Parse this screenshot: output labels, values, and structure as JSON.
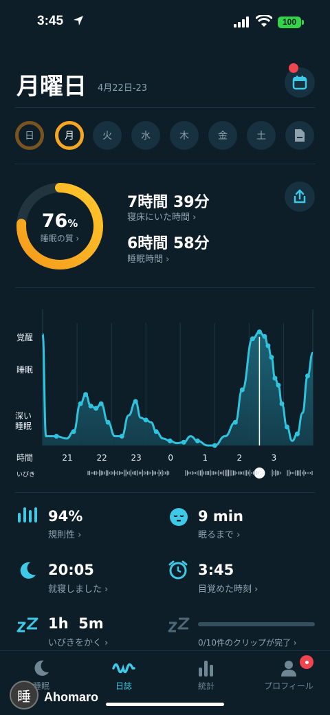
{
  "status_bar": {
    "time": "3:45",
    "battery": "100"
  },
  "header": {
    "title": "月曜日",
    "date_range": "4月22日-23"
  },
  "week_days": [
    "日",
    "月",
    "火",
    "水",
    "木",
    "金",
    "土"
  ],
  "summary": {
    "quality_value": "76",
    "quality_unit": "%",
    "quality_label": "睡眠の質 ›",
    "quality_fraction": 0.76,
    "time_in_bed": "7時間 39分",
    "time_in_bed_label": "寝床にいた時間 ›",
    "sleep_time": "6時間 58分",
    "sleep_time_label": "睡眠時間 ›"
  },
  "chart_data": {
    "type": "area",
    "y_levels": [
      "覚醒",
      "睡眠",
      "深い睡眠"
    ],
    "x_axis_label": "時間",
    "x_ticks": [
      "21",
      "22",
      "23",
      "0",
      "1",
      "2",
      "3"
    ],
    "snore_label": "いびき",
    "note": "sleep depth over time; 0 = 覚醒, 1 = 睡眠, 2 = 深い睡眠, 2.4 = bottom",
    "x": [
      20.0,
      20.1,
      20.4,
      20.7,
      20.9,
      21.1,
      21.25,
      21.4,
      21.55,
      21.7,
      21.9,
      22.1,
      22.3,
      22.5,
      22.7,
      22.85,
      23.0,
      23.15,
      23.3,
      23.5,
      23.7,
      23.9,
      24.1,
      24.3,
      24.5,
      24.8,
      25.0,
      25.3,
      25.6,
      25.8,
      26.1,
      26.3,
      26.45,
      26.55,
      26.65,
      26.75,
      26.85,
      26.95,
      27.1,
      27.25,
      27.4,
      27.55,
      27.7,
      27.85
    ],
    "y": [
      0.0,
      2.2,
      2.2,
      2.25,
      2.1,
      1.5,
      1.3,
      1.55,
      1.6,
      1.5,
      1.9,
      2.2,
      2.2,
      1.75,
      1.45,
      1.8,
      1.85,
      1.9,
      2.1,
      2.25,
      2.3,
      2.35,
      2.33,
      2.2,
      2.3,
      2.4,
      2.4,
      2.2,
      1.9,
      1.2,
      0.1,
      -0.05,
      0.05,
      0.25,
      0.5,
      0.95,
      1.1,
      1.5,
      2.0,
      2.3,
      2.15,
      1.7,
      0.9,
      0.4
    ],
    "current_time_x": 26.3
  },
  "stats": [
    {
      "icon": "regularity-icon",
      "value": "94%",
      "label": "規則性 ›"
    },
    {
      "icon": "sleepy-face-icon",
      "value": "9 min",
      "label": "眠るまで ›"
    },
    {
      "icon": "moon-icon",
      "value": "20:05",
      "label": "就寝しました ›"
    },
    {
      "icon": "alarm-clock-icon",
      "value": "3:45",
      "label": "目覚めた時刻 ›"
    },
    {
      "icon": "snore-zz-icon",
      "value": "1h  5m",
      "label": "いびきをかく ›"
    },
    {
      "icon": "snore-zz-icon",
      "value": "",
      "label": "0/10件のクリップが完了 ›"
    }
  ],
  "tabs": [
    {
      "label": "睡眠",
      "icon": "moon-icon"
    },
    {
      "label": "日誌",
      "icon": "wave-icon"
    },
    {
      "label": "統計",
      "icon": "bar-chart-icon"
    },
    {
      "label": "プロフィール",
      "icon": "person-icon"
    }
  ],
  "watermark": "Ahomaro",
  "colors": {
    "accent": "#3ec9e6",
    "ring": "#f5a623",
    "background": "#0d1e29"
  }
}
